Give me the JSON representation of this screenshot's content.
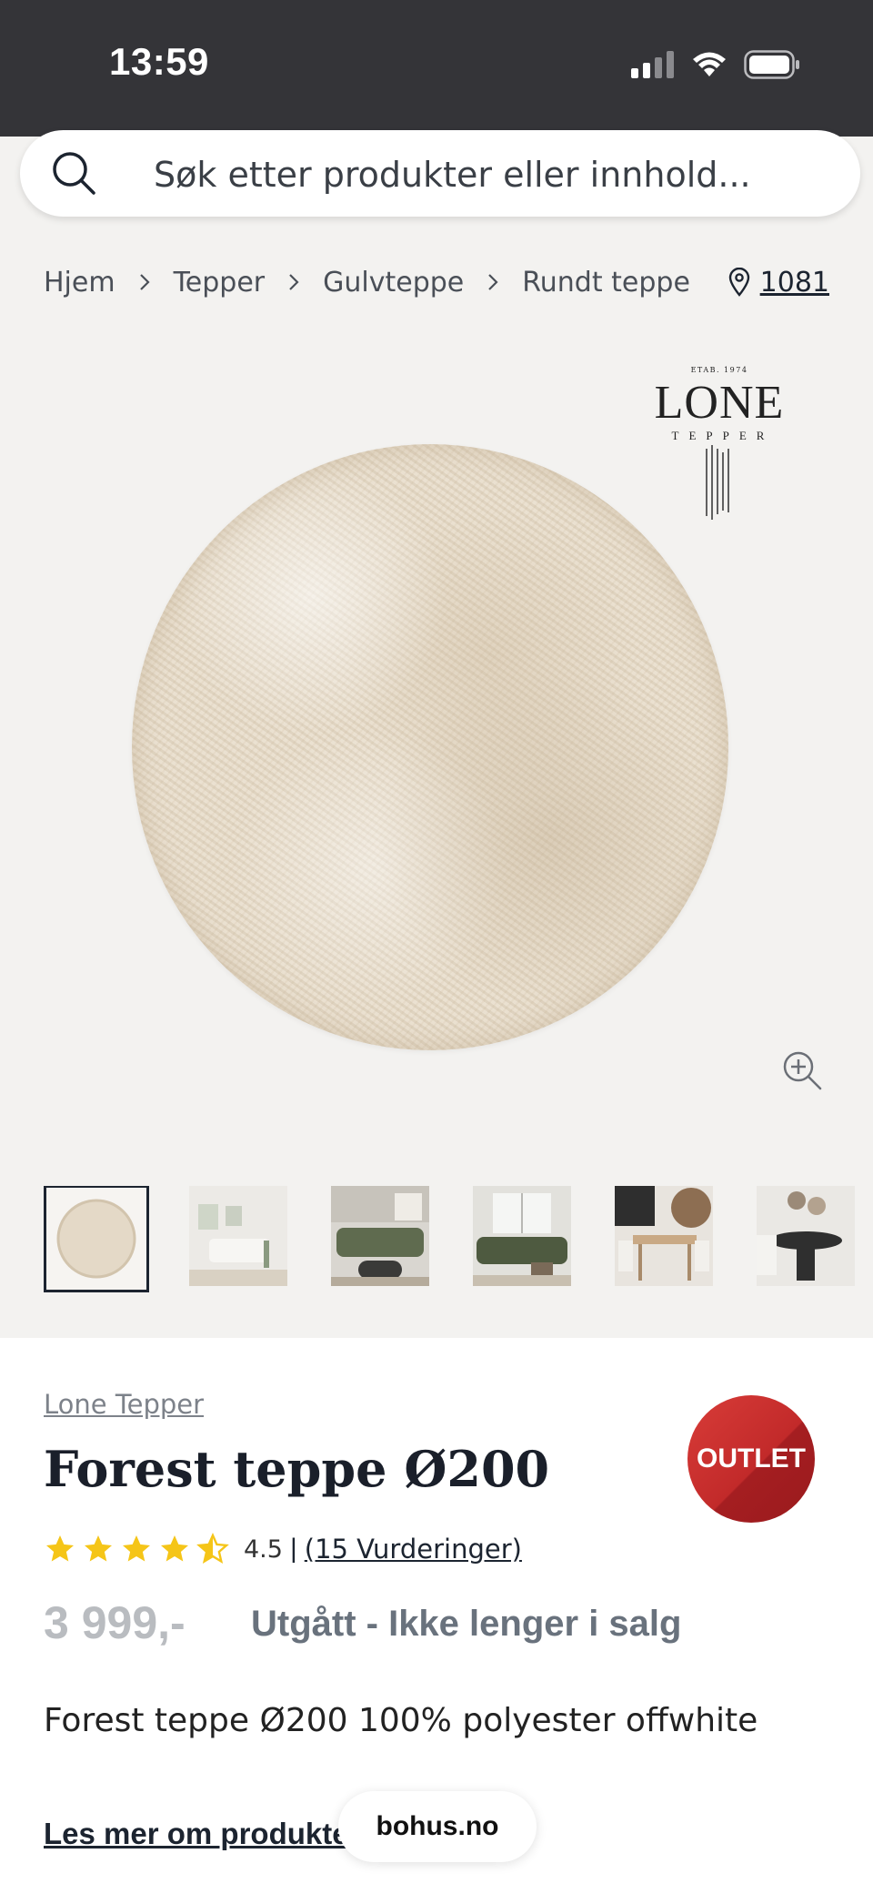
{
  "status_bar": {
    "time": "13:59"
  },
  "search": {
    "placeholder": "Søk etter produkter eller innhold..."
  },
  "breadcrumb": [
    "Hjem",
    "Tepper",
    "Gulvteppe",
    "Rundt teppe"
  ],
  "store": {
    "code": "1081",
    "icon": "location-pin-icon"
  },
  "logo": {
    "etab": "ETAB. 1974",
    "brand": "LONE",
    "sub": "TEPPER"
  },
  "gallery": {
    "thumbnails": [
      "rug",
      "living-room-white-sofa",
      "living-room-green-sofa",
      "living-room-green-sofa-window",
      "dining-table",
      "dining-round-table"
    ]
  },
  "product": {
    "brand": "Lone Tepper",
    "title": "Forest teppe Ø200",
    "badge": "OUTLET",
    "rating": {
      "value": "4.5",
      "stars": 4.5,
      "separator": "|",
      "count": "(15 Vurderinger)"
    },
    "price": "3 999,-",
    "availability": "Utgått - Ikke lenger i salg",
    "description": "Forest teppe Ø200 100% polyester offwhite",
    "read_more": "Les mer om produktet"
  },
  "browser": {
    "url": "bohus.no"
  },
  "colors": {
    "status_bar": "#343438",
    "outlet": "#c22a2a",
    "star": "#f5c518",
    "text": "#1c2430"
  }
}
